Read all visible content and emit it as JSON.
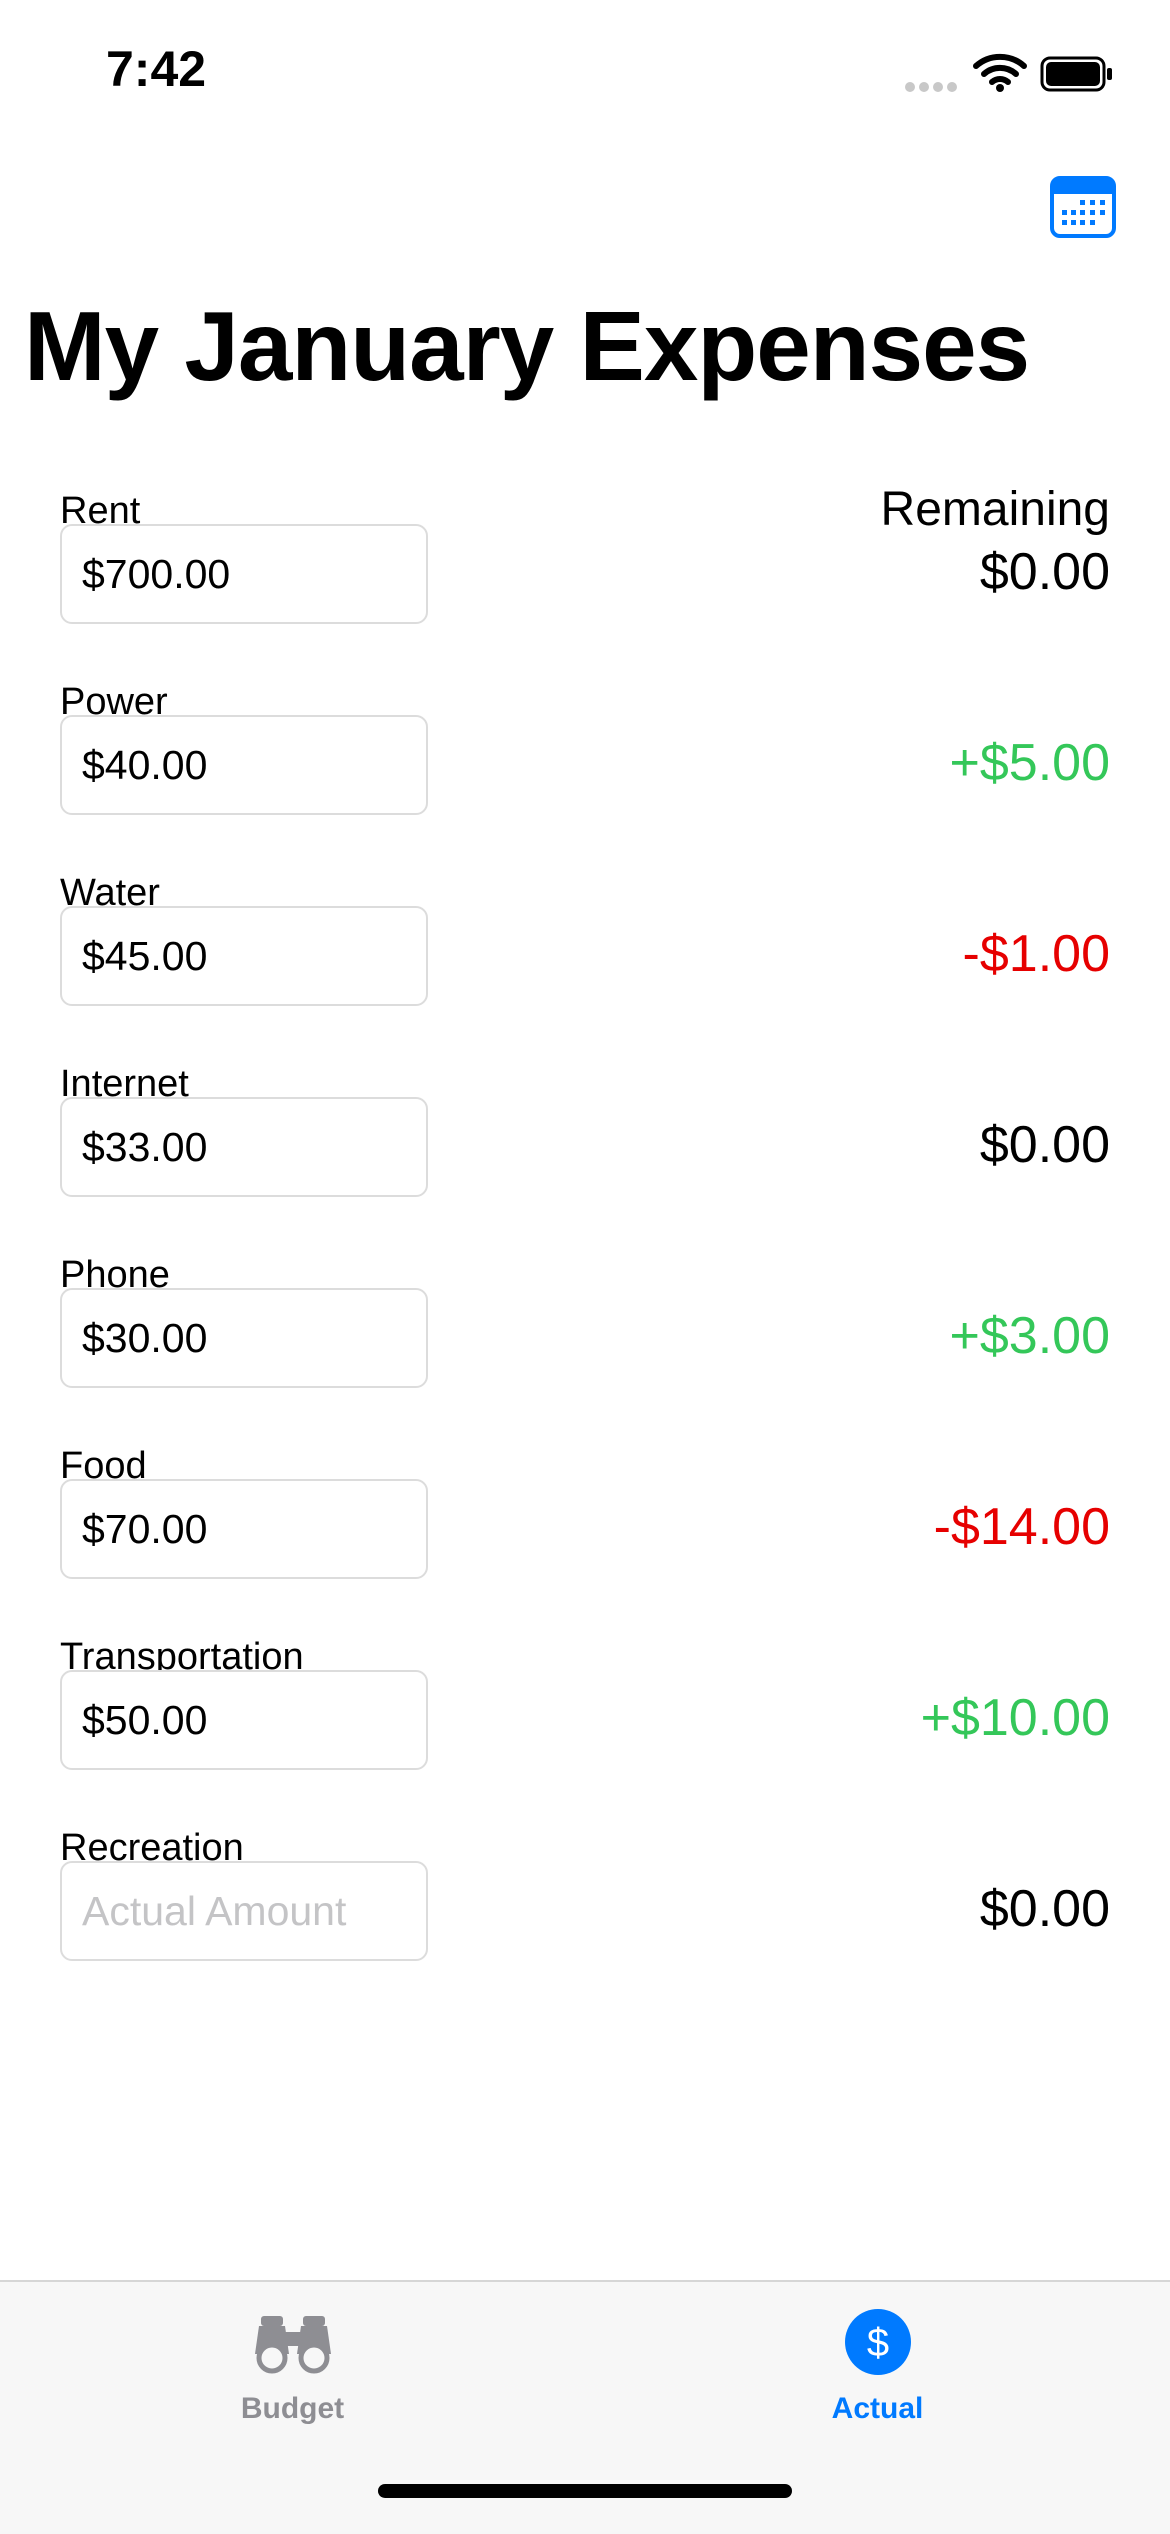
{
  "status": {
    "time": "7:42"
  },
  "title": "My January Expenses",
  "remaining_header": "Remaining",
  "rows": [
    {
      "label": "Rent",
      "value": "$700.00",
      "placeholder": "Actual Amount",
      "remaining": "$0.00",
      "status": "neutral"
    },
    {
      "label": "Power",
      "value": "$40.00",
      "placeholder": "Actual Amount",
      "remaining": "+$5.00",
      "status": "positive"
    },
    {
      "label": "Water",
      "value": "$45.00",
      "placeholder": "Actual Amount",
      "remaining": "-$1.00",
      "status": "negative"
    },
    {
      "label": "Internet",
      "value": "$33.00",
      "placeholder": "Actual Amount",
      "remaining": "$0.00",
      "status": "neutral"
    },
    {
      "label": "Phone",
      "value": "$30.00",
      "placeholder": "Actual Amount",
      "remaining": "+$3.00",
      "status": "positive"
    },
    {
      "label": "Food",
      "value": "$70.00",
      "placeholder": "Actual Amount",
      "remaining": "-$14.00",
      "status": "negative"
    },
    {
      "label": "Transportation",
      "value": "$50.00",
      "placeholder": "Actual Amount",
      "remaining": "+$10.00",
      "status": "positive"
    },
    {
      "label": "Recreation",
      "value": "",
      "placeholder": "Actual Amount",
      "remaining": "$0.00",
      "status": "neutral"
    }
  ],
  "tabs": [
    {
      "label": "Budget",
      "icon": "binoculars-icon",
      "active": false
    },
    {
      "label": "Actual",
      "icon": "dollar-circle-icon",
      "active": true
    }
  ],
  "colors": {
    "accent": "#007aff",
    "positive": "#34c759",
    "negative": "#e60000",
    "inactive_tab": "#8e8e93"
  }
}
